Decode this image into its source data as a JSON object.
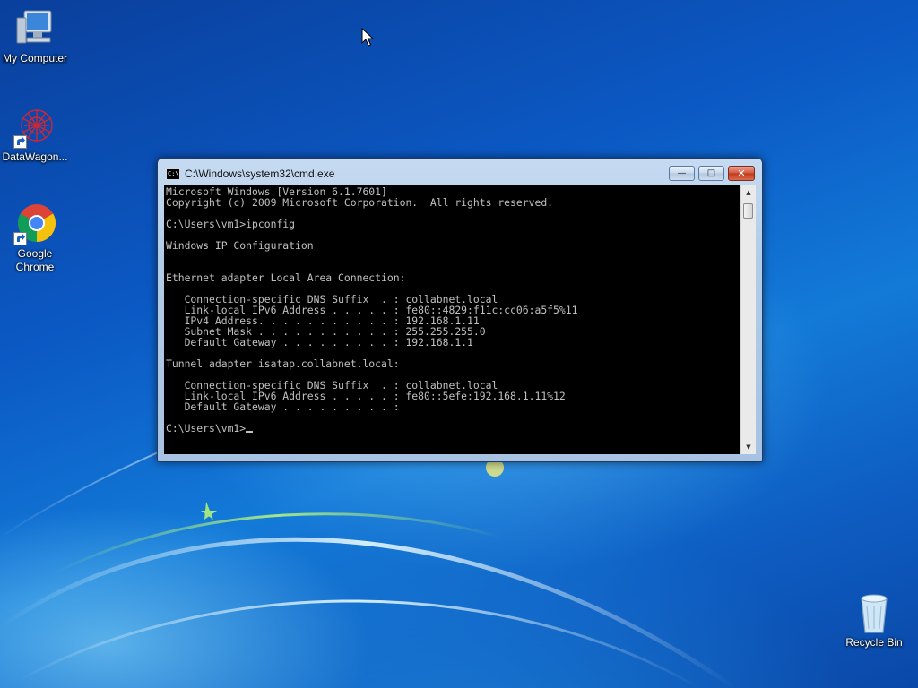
{
  "desktop": {
    "icons": [
      {
        "label": "My Computer",
        "icon": "computer-icon"
      },
      {
        "label": "DataWagon...",
        "icon": "datawagon-icon"
      },
      {
        "label_line1": "Google",
        "label_line2": "Chrome",
        "icon": "chrome-icon"
      },
      {
        "label": "Recycle Bin",
        "icon": "recycle-bin-icon"
      }
    ]
  },
  "window": {
    "title": "C:\\Windows\\system32\\cmd.exe",
    "icon_text": "C:\\",
    "controls": {
      "minimize": "—",
      "maximize": "□",
      "close": "✕"
    },
    "console_output": "Microsoft Windows [Version 6.1.7601]\nCopyright (c) 2009 Microsoft Corporation.  All rights reserved.\n\nC:\\Users\\vm1>ipconfig\n\nWindows IP Configuration\n\n\nEthernet adapter Local Area Connection:\n\n   Connection-specific DNS Suffix  . : collabnet.local\n   Link-local IPv6 Address . . . . . : fe80::4829:f11c:cc06:a5f5%11\n   IPv4 Address. . . . . . . . . . . : 192.168.1.11\n   Subnet Mask . . . . . . . . . . . : 255.255.255.0\n   Default Gateway . . . . . . . . . : 192.168.1.1\n\nTunnel adapter isatap.collabnet.local:\n\n   Connection-specific DNS Suffix  . : collabnet.local\n   Link-local IPv6 Address . . . . . : fe80::5efe:192.168.1.11%12\n   Default Gateway . . . . . . . . . :\n\n",
    "prompt": "C:\\Users\\vm1>"
  },
  "colors": {
    "console_bg": "#000000",
    "console_text": "#c0c0c0",
    "close_button": "#c7401f"
  }
}
